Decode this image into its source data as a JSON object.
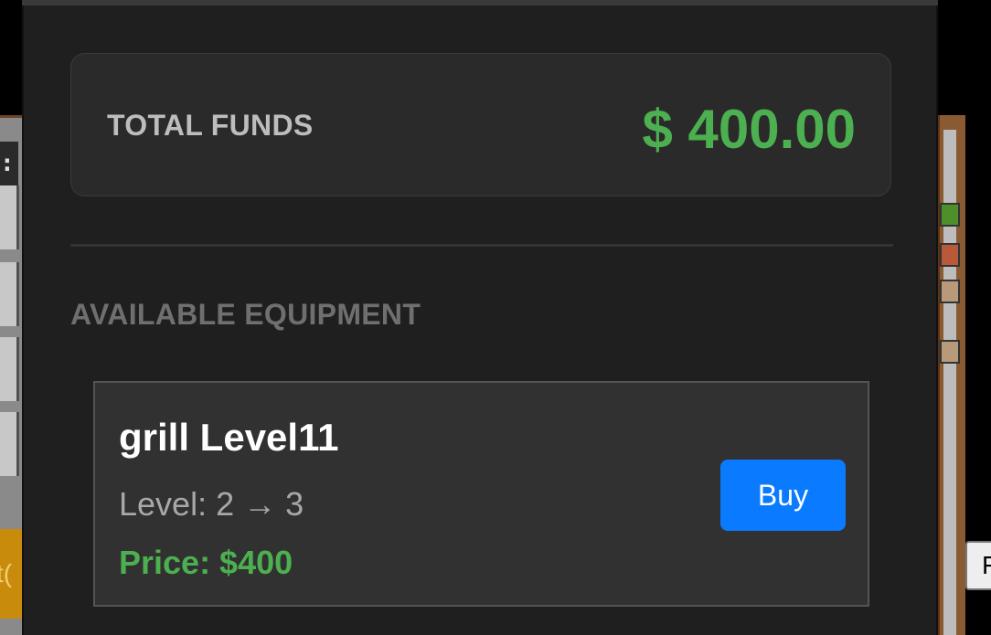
{
  "background": {
    "left_text": ":",
    "left_orange_text": "t(",
    "right_button_text": "F"
  },
  "shop": {
    "funds": {
      "label": "TOTAL FUNDS",
      "value": "$ 400.00"
    },
    "section_title": "AVAILABLE EQUIPMENT",
    "items": [
      {
        "name": "grill Level11",
        "level_text": "Level: 2 → 3",
        "price_text": "Price: $400",
        "buy_label": "Buy"
      }
    ]
  },
  "colors": {
    "panel_bg": "#1f1f1f",
    "card_bg": "#2a2a2a",
    "funds_green": "#4caf50",
    "buy_blue": "#0a7bff"
  }
}
